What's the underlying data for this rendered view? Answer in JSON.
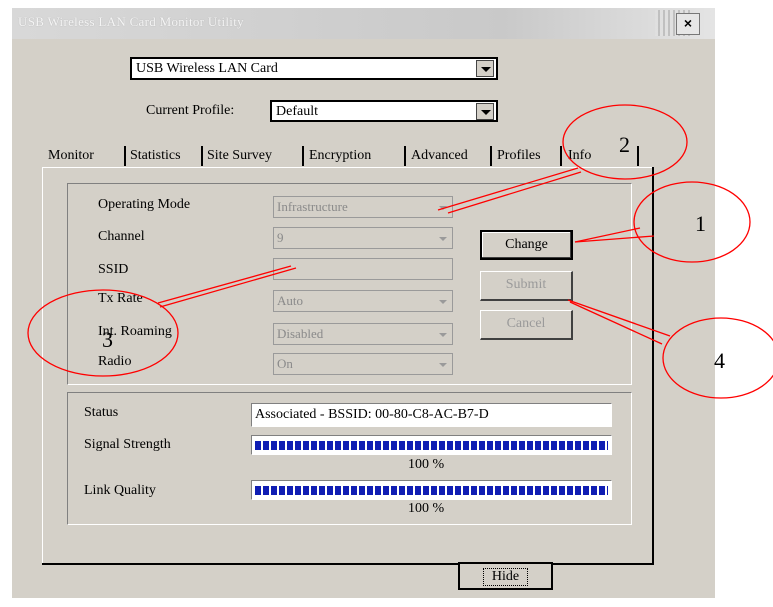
{
  "window": {
    "title": "USB Wireless LAN Card Monitor Utility",
    "close_symbol": "×"
  },
  "adapter_select": {
    "value": "USB Wireless LAN Card"
  },
  "profile": {
    "label": "Current Profile:",
    "value": "Default"
  },
  "tabs": [
    {
      "label": "Monitor",
      "selected": true
    },
    {
      "label": "Statistics"
    },
    {
      "label": "Site Survey"
    },
    {
      "label": "Encryption"
    },
    {
      "label": "Advanced"
    },
    {
      "label": "Profiles"
    },
    {
      "label": "Info"
    }
  ],
  "settings": {
    "operating_mode": {
      "label": "Operating Mode",
      "value": "Infrastructure"
    },
    "channel": {
      "label": "Channel",
      "value": "9"
    },
    "ssid": {
      "label": "SSID",
      "value": ""
    },
    "tx_rate": {
      "label": "Tx Rate",
      "value": "Auto"
    },
    "int_roaming": {
      "label": "Int. Roaming",
      "value": "Disabled"
    },
    "radio": {
      "label": "Radio",
      "value": "On"
    }
  },
  "buttons": {
    "change": "Change",
    "submit": "Submit",
    "cancel": "Cancel",
    "hide": "Hide"
  },
  "status": {
    "label": "Status",
    "value": "Associated - BSSID: 00-80-C8-AC-B7-D",
    "signal_label": "Signal Strength",
    "signal_percent": 100,
    "signal_text": "100 %",
    "link_label": "Link Quality",
    "link_percent": 100,
    "link_text": "100 %"
  },
  "callouts": [
    "1",
    "2",
    "3",
    "4"
  ],
  "colors": {
    "callout": "#ff0000",
    "meter": "#0f1db3",
    "dialog": "#d4d0c8"
  }
}
